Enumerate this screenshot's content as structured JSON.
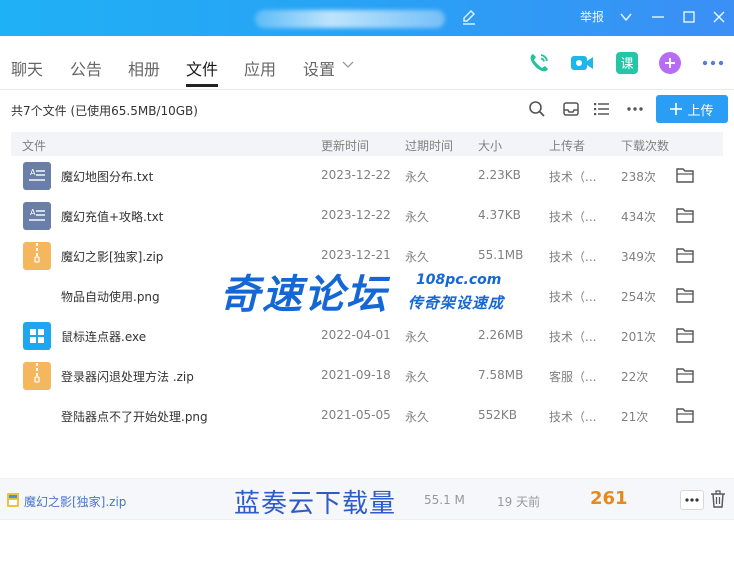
{
  "titlebar": {
    "report_label": "举报",
    "colors": {
      "start": "#1fb1f5",
      "end": "#3b8ff5"
    }
  },
  "tabs": [
    {
      "label": "聊天",
      "active": false
    },
    {
      "label": "公告",
      "active": false
    },
    {
      "label": "相册",
      "active": false
    },
    {
      "label": "文件",
      "active": true
    },
    {
      "label": "应用",
      "active": false
    },
    {
      "label": "设置",
      "active": false
    }
  ],
  "top_icons": [
    "phone-icon",
    "video-icon",
    "class-icon",
    "add-app-icon",
    "more-icon"
  ],
  "summary": {
    "text": "共7个文件 (已使用65.5MB/10GB)",
    "upload_label": "上传"
  },
  "table": {
    "headers": [
      "文件",
      "更新时间",
      "过期时间",
      "大小",
      "上传者",
      "下载次数"
    ],
    "rows": [
      {
        "icon": "text-file-icon",
        "name": "魔幻地图分布.txt",
        "updated": "2023-12-22",
        "expires": "永久",
        "size": "2.23KB",
        "uploader": "技术（...",
        "downloads": "238次"
      },
      {
        "icon": "text-file-icon",
        "name": "魔幻充值+攻略.txt",
        "updated": "2023-12-22",
        "expires": "永久",
        "size": "4.37KB",
        "uploader": "技术（...",
        "downloads": "434次"
      },
      {
        "icon": "zip-file-icon",
        "name": "魔幻之影[独家].zip",
        "updated": "2023-12-21",
        "expires": "永久",
        "size": "55.1MB",
        "uploader": "技术（...",
        "downloads": "349次"
      },
      {
        "icon": "image-file-icon",
        "name": "物品自动使用.png",
        "updated": "",
        "expires": "",
        "size": "",
        "uploader": "技术（...",
        "downloads": "254次"
      },
      {
        "icon": "exe-file-icon",
        "name": "鼠标连点器.exe",
        "updated": "2022-04-01",
        "expires": "永久",
        "size": "2.26MB",
        "uploader": "技术（...",
        "downloads": "201次"
      },
      {
        "icon": "zip-file-icon",
        "name": "登录器闪退处理方法 .zip",
        "updated": "2021-09-18",
        "expires": "永久",
        "size": "7.58MB",
        "uploader": "客服（...",
        "downloads": "22次"
      },
      {
        "icon": "image-file-icon",
        "name": "登陆器点不了开始处理.png",
        "updated": "2021-05-05",
        "expires": "永久",
        "size": "552KB",
        "uploader": "技术（...",
        "downloads": "21次"
      }
    ]
  },
  "watermark": {
    "main": "奇速论坛",
    "domain": "108pc.com",
    "slogan": "传奇架设速成"
  },
  "download_bar": {
    "file_name": "魔幻之影[独家].zip",
    "label": "蓝奏云下载量",
    "size": "55.1 M",
    "age": "19 天前",
    "count": "261"
  }
}
